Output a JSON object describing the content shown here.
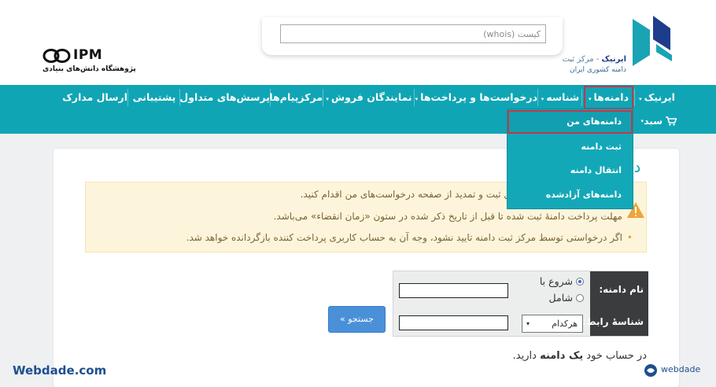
{
  "header": {
    "whois_placeholder": "کیست (whois)",
    "ipm_logo_text": "IPM",
    "ipm_subtitle": "پژوهشگاه دانش‌های بنیادی",
    "irnic_name_bold": "ایرنیک",
    "irnic_name_rest": " - مرکز ثبت",
    "irnic_subtitle": "دامنه کشوری ایران"
  },
  "nav": {
    "items": [
      {
        "label": "ایرنیک",
        "caret": "▾"
      },
      {
        "label": "دامنه‌ها",
        "caret": "▾"
      },
      {
        "label": "شناسه",
        "caret": "▾"
      },
      {
        "label": "درخواست‌ها و پرداخت‌ها",
        "caret": "▾"
      },
      {
        "label": "نمایندگان فروش",
        "caret": "▾"
      },
      {
        "label": "مرکزپیام‌ها",
        "caret": ""
      },
      {
        "label": "پرسش‌های متداول",
        "caret": ""
      },
      {
        "label": "پشتیبانی",
        "caret": ""
      },
      {
        "label": "ارسال مدارک",
        "caret": ""
      }
    ],
    "cart_label": "سبد",
    "cart_caret": "▾"
  },
  "dropdown": {
    "items": [
      "دامنه‌های من",
      "ثبت دامنه",
      "انتقال دامنه",
      "دامنه‌های آزادشده"
    ]
  },
  "main": {
    "title": "دا",
    "alert_lines": [
      "ست‌ها از قبیل ثبت و تمدید از صفحه درخواست‌های من اقدام کنید.",
      "مهلت پرداخت دامنهٔ ثبت شده تا قبل از تاریخ ذکر شده در ستون «زمان انقضاء» می‌باشد.",
      "اگر درخواستی توسط مرکز ثبت دامنه تایید نشود، وجه آن به حساب کاربری پرداخت کننده بازگردانده خواهد شد."
    ],
    "alert_bullet": "•"
  },
  "form": {
    "domain_label": "نام دامنه:",
    "contact_label": "شناسهٔ رابط:",
    "radio_starts": "شروع با",
    "radio_contains": "شامل",
    "select_value": "هرکدام",
    "select_arrow": "▾",
    "search_button": "جستجو »"
  },
  "result": {
    "prefix": "در حساب خود ",
    "bold": "یک دامنه",
    "suffix": " دارید."
  },
  "watermarks": {
    "left": "Webdade.com",
    "right": "webdade"
  },
  "colors": {
    "nav_bg": "#10a5b5",
    "highlight_border": "#c0394b",
    "alert_bg": "#fcf5dc",
    "button_blue": "#4a90d9"
  }
}
